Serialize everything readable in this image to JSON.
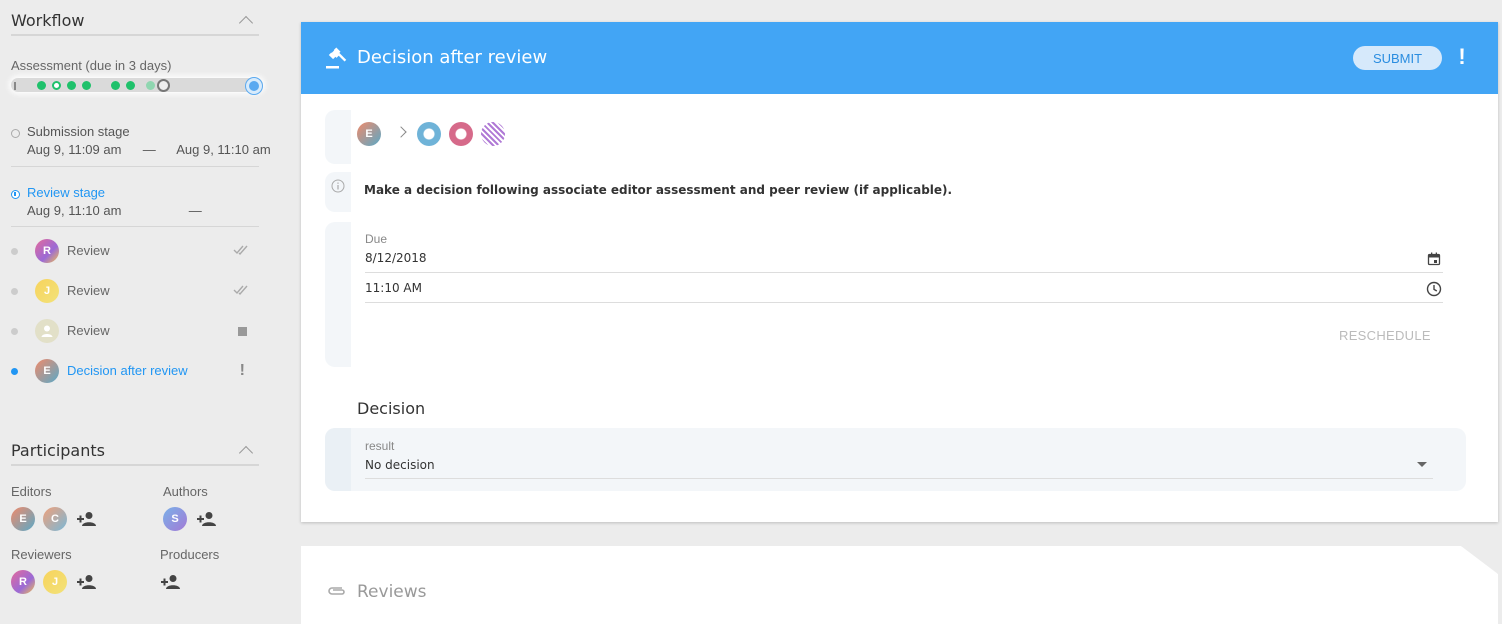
{
  "sidebar": {
    "workflow_title": "Workflow",
    "assessment_label": "Assessment (due in 3 days)",
    "stages": [
      {
        "name": "Submission stage",
        "start": "Aug 9, 11:09 am",
        "sep": "—",
        "end": "Aug 9, 11:10 am"
      },
      {
        "name": "Review stage",
        "start": "Aug 9, 11:10 am",
        "sep": "—",
        "end": ""
      }
    ],
    "tasks": [
      {
        "initial": "R",
        "label": "Review",
        "status_icon": "double-check-icon"
      },
      {
        "initial": "J",
        "label": "Review",
        "status_icon": "double-check-icon"
      },
      {
        "initial": "",
        "label": "Review",
        "status_icon": "square-icon"
      },
      {
        "initial": "E",
        "label": "Decision after review",
        "status": "!"
      }
    ],
    "participants_title": "Participants",
    "groups": {
      "editors": {
        "label": "Editors",
        "avatars": [
          "E",
          "C"
        ]
      },
      "authors": {
        "label": "Authors",
        "avatars": [
          "S"
        ]
      },
      "reviewers": {
        "label": "Reviewers",
        "avatars": [
          "R",
          "J"
        ]
      },
      "producers": {
        "label": "Producers",
        "avatars": []
      }
    }
  },
  "card": {
    "title": "Decision after review",
    "submit_label": "SUBMIT",
    "alert": "!",
    "assignee_initial": "E",
    "instruction": "Make a decision following associate editor assessment and peer review (if applicable).",
    "due_label": "Due",
    "due_date": "8/12/2018",
    "due_time": "11:10  AM",
    "reschedule_label": "RESCHEDULE",
    "decision_title": "Decision",
    "result_label": "result",
    "result_value": "No decision"
  },
  "reviews": {
    "title": "Reviews"
  },
  "colors": {
    "header_blue": "#42a5f5",
    "active_blue": "#2196f3",
    "progress_green": "#1fc16b"
  }
}
